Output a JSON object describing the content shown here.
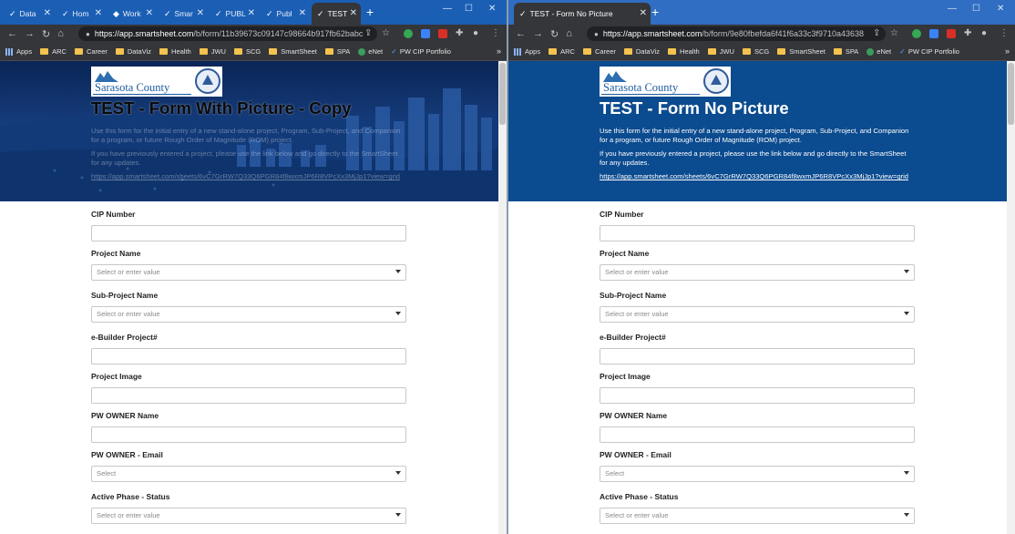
{
  "left": {
    "tabs": [
      {
        "label": "Data"
      },
      {
        "label": "Hom"
      },
      {
        "label": "Work"
      },
      {
        "label": "Smar"
      },
      {
        "label": "PUBL"
      },
      {
        "label": "Publ"
      },
      {
        "label": "TEST"
      }
    ],
    "url": {
      "host": "https://app.smartsheet.com",
      "path": "/b/form/11b39673c09147c98664b917fb62babc"
    },
    "form": {
      "title": "TEST - Form With Picture - Copy",
      "desc1": "Use this form for the initial entry of a new stand-alone project, Program, Sub-Project, and Companion for a program, or future Rough Order of Magnitude (ROM) project.",
      "desc2": "If you have previously entered a project, please use the link below and go directly to the SmartSheet for any updates.",
      "link": "https://app.smartsheet.com/sheets/6vC7GrRW7Q33Q6PGR84f8wxmJP6R8VPcXx3MjJp1?view=grid"
    }
  },
  "right": {
    "tabs": [
      {
        "label": "TEST - Form No Picture"
      }
    ],
    "url": {
      "host": "https://app.smartsheet.com",
      "path": "/b/form/9e80fbefda6f41f6a33c3f9710a43638"
    },
    "form": {
      "title": "TEST - Form No Picture",
      "desc1": "Use this form for the initial entry of a new stand-alone project, Program, Sub-Project, and Companion for a program, or future Rough Order of Magnitude (ROM) project.",
      "desc2": "If you have previously entered a project, please use the link below and go directly to the SmartSheet for any updates.",
      "link": "https://app.smartsheet.com/sheets/6vC7GrRW7Q33Q6PGR84f8wxmJP6R8VPcXx3MjJp1?view=grid"
    }
  },
  "bookmarks": [
    "Apps",
    "ARC",
    "Career",
    "DataViz",
    "Health",
    "JWU",
    "SCG",
    "SmartSheet",
    "SPA",
    "eNet",
    "PW CIP Portfolio"
  ],
  "logo": {
    "county": "Sarasota County"
  },
  "fields": [
    {
      "label": "CIP Number",
      "placeholder": ""
    },
    {
      "label": "Project Name",
      "placeholder": "Select or enter value"
    },
    {
      "label": "Sub-Project Name",
      "placeholder": "Select or enter value"
    },
    {
      "label": "e-Builder Project#",
      "placeholder": ""
    },
    {
      "label": "Project Image",
      "placeholder": ""
    },
    {
      "label": "PW OWNER Name",
      "placeholder": ""
    },
    {
      "label": "PW OWNER - Email",
      "placeholder": "Select"
    },
    {
      "label": "Active Phase - Status",
      "placeholder": "Select or enter value"
    }
  ],
  "icons": {
    "back": "←",
    "forward": "→",
    "reload": "↻",
    "home": "⌂",
    "lock": "🔒",
    "star": "☆",
    "menu": "⋮",
    "more": "»",
    "newtab": "+",
    "close": "✕"
  },
  "colors": {
    "tabbar": "#1b5fb5",
    "hero_blue": "#0b4b8f",
    "link_check": "#4fa3ff"
  }
}
